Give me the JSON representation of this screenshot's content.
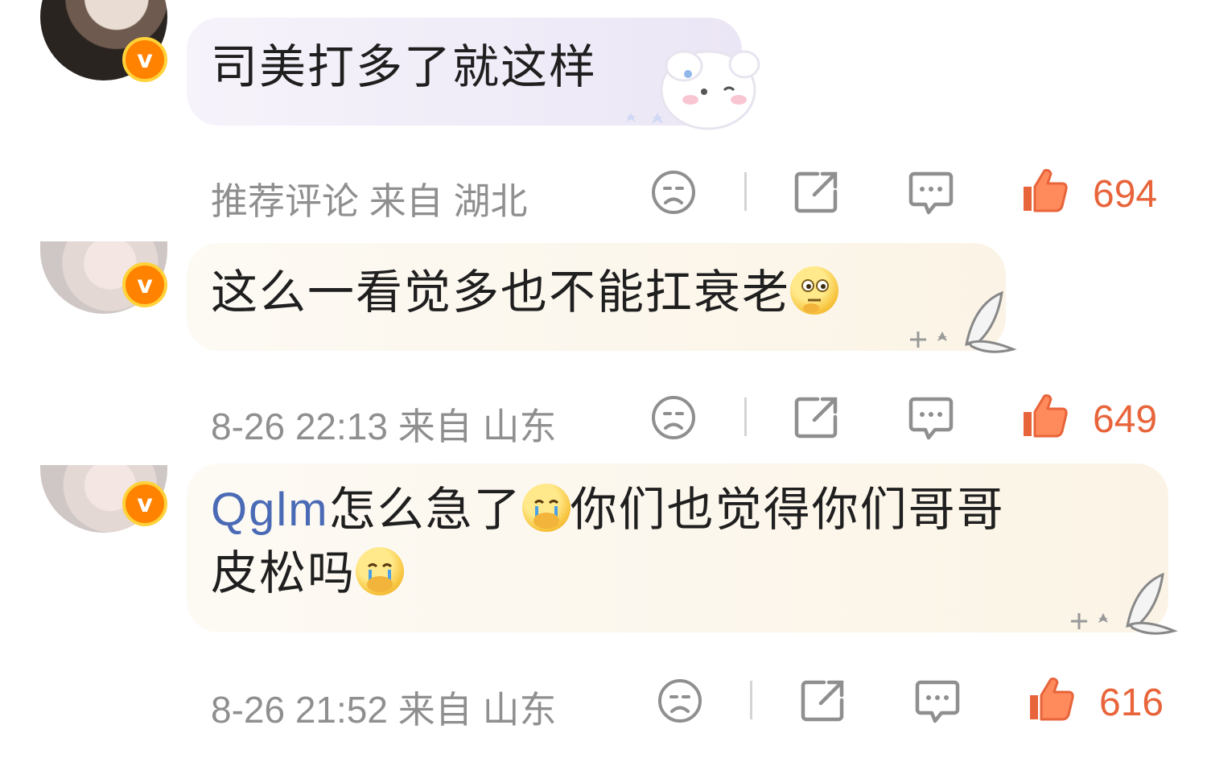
{
  "comments": [
    {
      "text": "司美打多了就这样",
      "meta": "推荐评论  来自 湖北",
      "likes": "694",
      "badge": "v"
    },
    {
      "text": "这么一看觉多也不能扛衰老",
      "meta": "8-26 22:13  来自 山东",
      "likes": "649",
      "badge": "v"
    },
    {
      "mention": "Qglm",
      "text_line1": "怎么急了",
      "text_line1b": "你们也觉得你们哥哥",
      "text_line2": "皮松吗",
      "meta": "8-26 21:52  来自 山东",
      "likes": "616",
      "badge": "v"
    }
  ],
  "colors": {
    "accent": "#e8643a",
    "meta_gray": "#8f8f8f",
    "mention_blue": "#4a6ab6",
    "badge_orange": "#ff8200"
  },
  "icons": [
    "frown-icon",
    "share-icon",
    "comment-icon",
    "thumbs-up-icon",
    "thinking-emoji-icon",
    "crying-emoji-icon",
    "bunny-sticker-icon",
    "butterfly-icon"
  ]
}
